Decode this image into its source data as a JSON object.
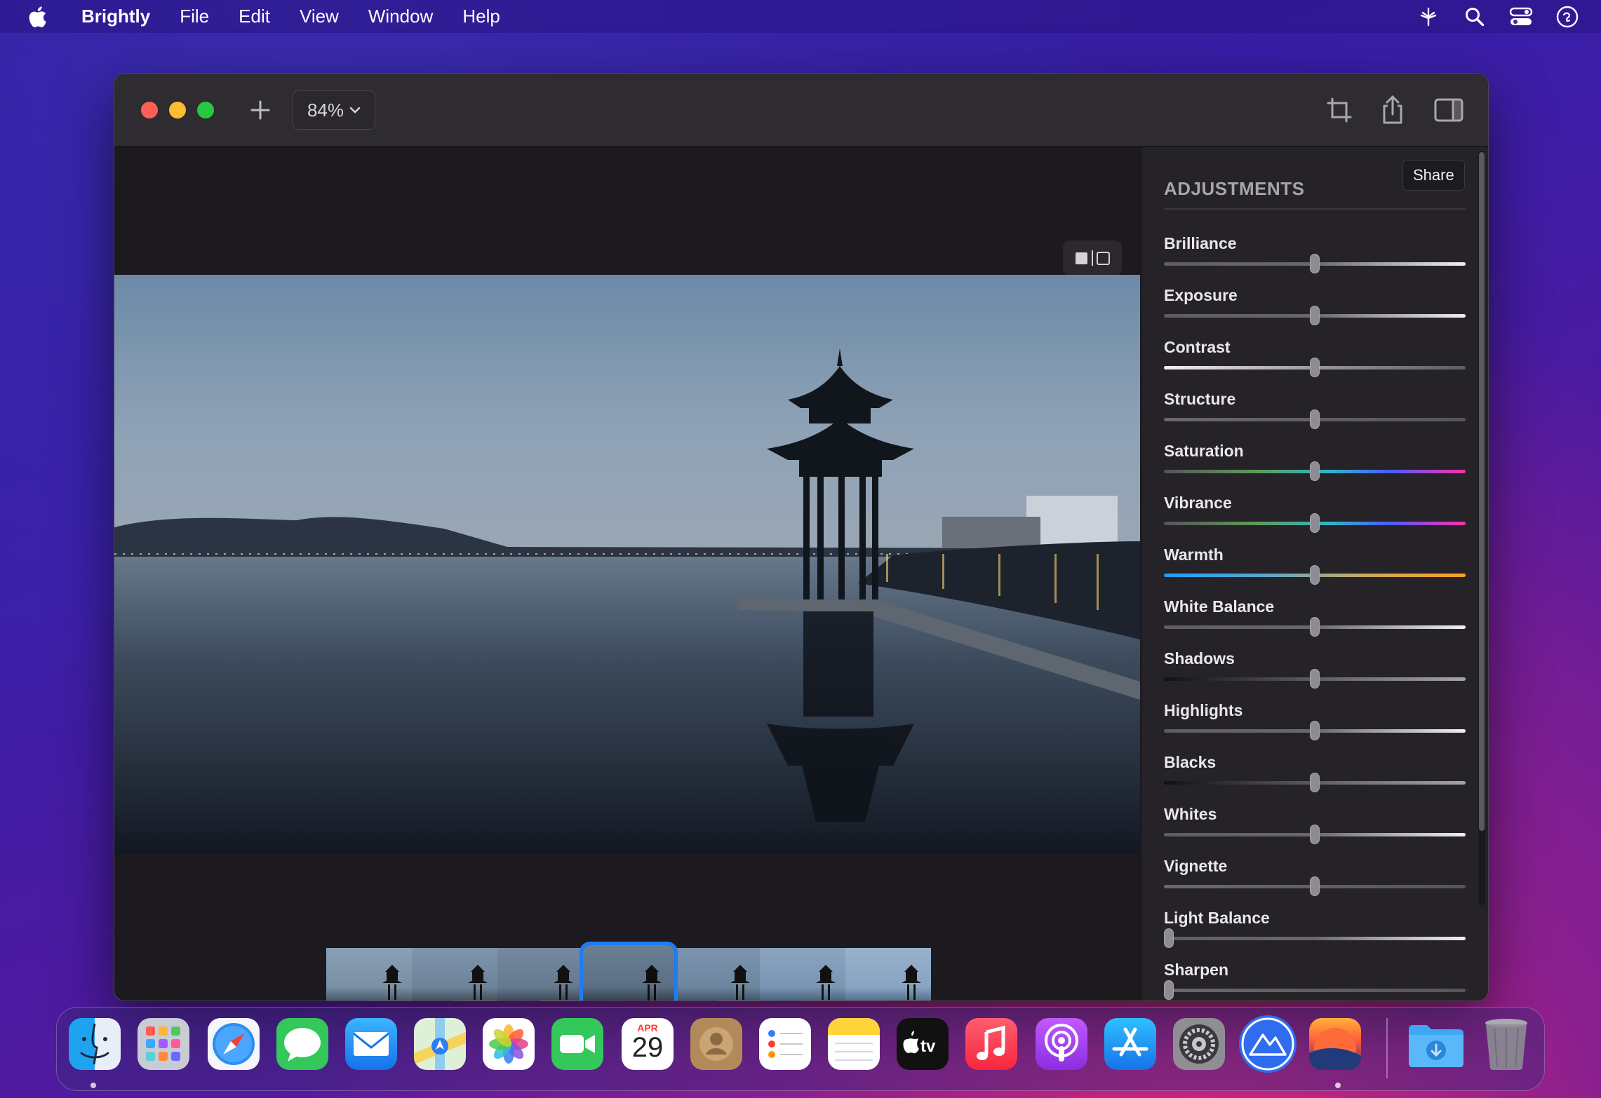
{
  "menubar": {
    "app": "Brightly",
    "items": [
      "File",
      "Edit",
      "View",
      "Window",
      "Help"
    ],
    "right_icons": [
      "dictation-icon",
      "search-icon",
      "control-center-icon",
      "siri-icon"
    ]
  },
  "toolbar": {
    "zoom": "84%",
    "icons": [
      "add-icon",
      "crop-icon",
      "share-icon",
      "sidebar-icon"
    ]
  },
  "sidebar": {
    "title": "ADJUSTMENTS",
    "tooltip": "Share",
    "sliders": [
      {
        "label": "Brilliance",
        "value": 0.5,
        "track": "neutral-light"
      },
      {
        "label": "Exposure",
        "value": 0.5,
        "track": "neutral-light"
      },
      {
        "label": "Contrast",
        "value": 0.5,
        "track": "light-dark"
      },
      {
        "label": "Structure",
        "value": 0.5,
        "track": "neutral-dark"
      },
      {
        "label": "Saturation",
        "value": 0.5,
        "track": "saturation"
      },
      {
        "label": "Vibrance",
        "value": 0.5,
        "track": "saturation"
      },
      {
        "label": "Warmth",
        "value": 0.5,
        "track": "warmth"
      },
      {
        "label": "White Balance",
        "value": 0.5,
        "track": "neutral-light"
      },
      {
        "label": "Shadows",
        "value": 0.5,
        "track": "dark-light"
      },
      {
        "label": "Highlights",
        "value": 0.5,
        "track": "neutral-light"
      },
      {
        "label": "Blacks",
        "value": 0.5,
        "track": "dark-light"
      },
      {
        "label": "Whites",
        "value": 0.5,
        "track": "neutral-light"
      },
      {
        "label": "Vignette",
        "value": 0.5,
        "track": "neutral-dark"
      },
      {
        "label": "Light Balance",
        "value": 0.0,
        "track": "neutral-light"
      },
      {
        "label": "Sharpen",
        "value": 0.0,
        "track": "neutral-dark"
      }
    ]
  },
  "filmstrip": {
    "count": 7,
    "selected": 3
  },
  "calendar": {
    "month": "APR",
    "day": "29"
  },
  "colors": {
    "accent": "#1e7cf5",
    "window_bg": "#1e1c21",
    "sidebar_bg": "#252328"
  },
  "dock": [
    "finder-icon",
    "launchpad-icon",
    "safari-icon",
    "messages-icon",
    "mail-icon",
    "maps-icon",
    "photos-icon",
    "facetime-icon",
    "calendar-icon",
    "contacts-icon",
    "reminders-icon",
    "notes-icon",
    "tv-icon",
    "music-icon",
    "podcasts-icon",
    "app-store-icon",
    "system-settings-icon",
    "brightly-icon",
    "wallpaper-icon",
    "downloads-folder-icon",
    "trash-icon"
  ]
}
